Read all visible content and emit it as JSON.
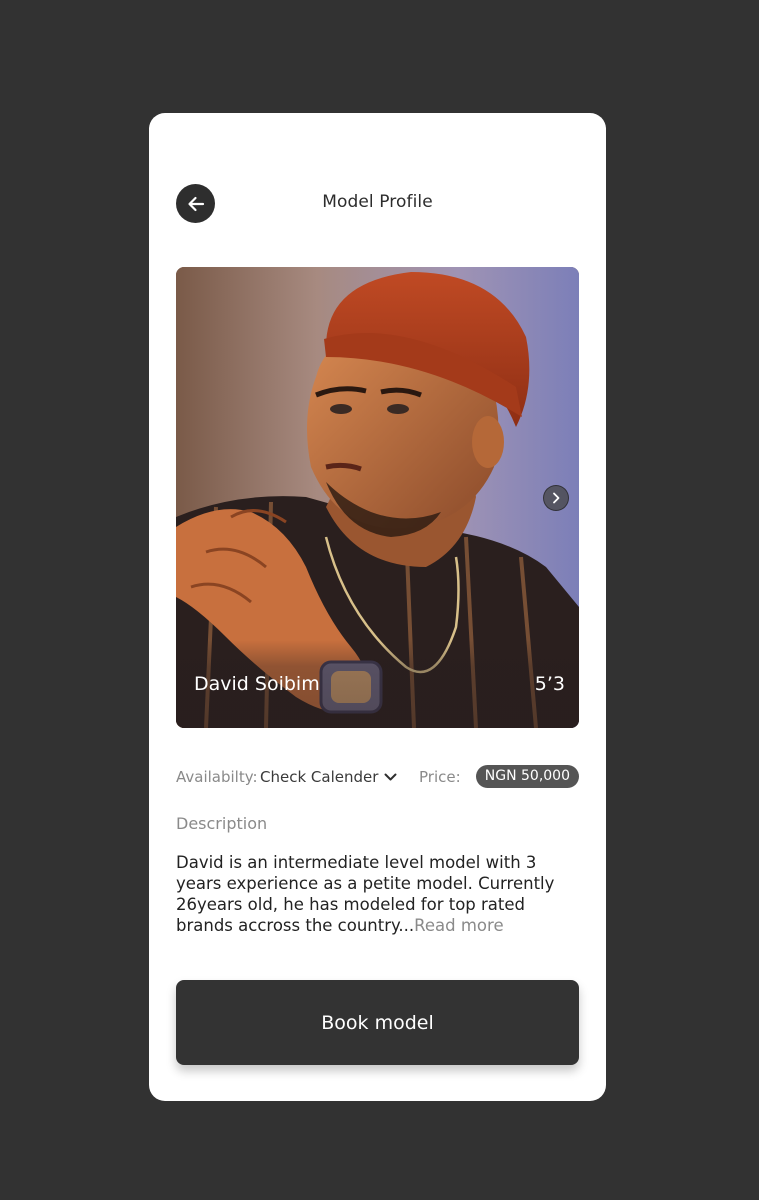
{
  "header": {
    "title": "Model Profile",
    "back_icon": "arrow-left-icon"
  },
  "profile": {
    "name": "David Soibim",
    "height": "5’3",
    "next_icon": "chevron-right-icon"
  },
  "details": {
    "availability_label": "Availabilty:",
    "availability_value": "Check Calender",
    "availability_icon": "chevron-down-icon",
    "price_label": "Price:",
    "price_value": "NGN 50,000"
  },
  "description": {
    "label": "Description",
    "text": "David is an intermediate level model with 3 years experience as a petite model. Currently 26years old, he has modeled for top rated brands accross the country...",
    "read_more": "Read more"
  },
  "actions": {
    "book_label": "Book model"
  },
  "colors": {
    "background": "#323232",
    "card": "#ffffff",
    "primary_dark": "#333333",
    "muted_text": "#8a8a8a",
    "badge": "#555555"
  }
}
